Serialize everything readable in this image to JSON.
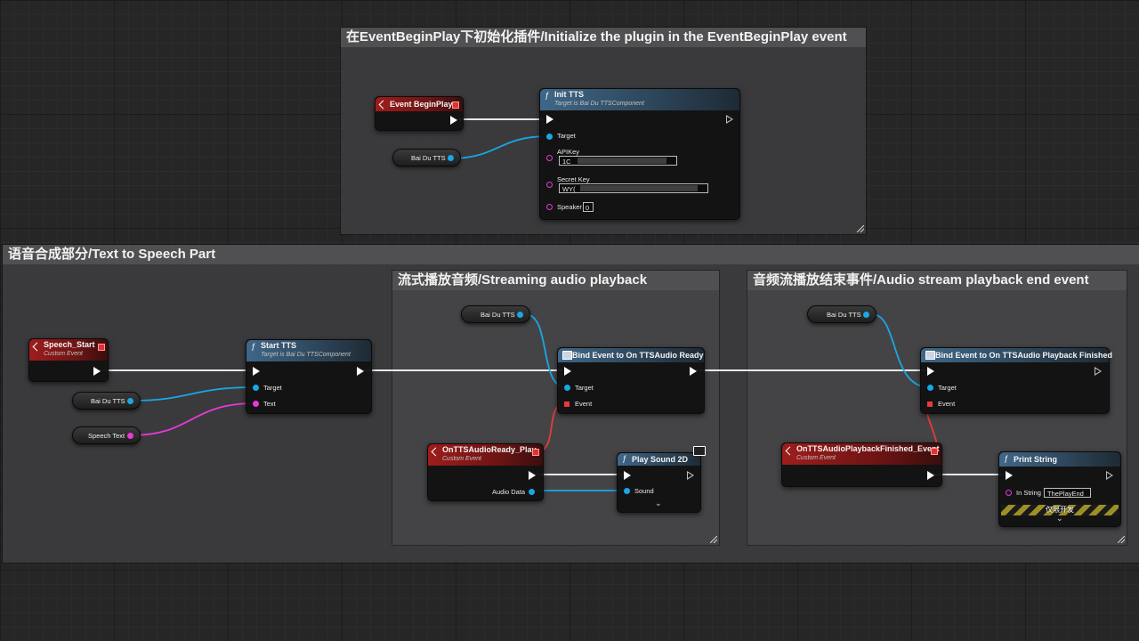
{
  "comments": {
    "init": "在EventBeginPlay下初始化插件/Initialize the plugin in the EventBeginPlay event",
    "tts": "语音合成部分/Text to Speech Part",
    "streaming": "流式播放音频/Streaming audio playback",
    "end_event": "音频流播放结束事件/Audio stream playback end event"
  },
  "nodes": {
    "event_begin_play": {
      "title": "Event BeginPlay"
    },
    "init_tts": {
      "title": "Init TTS",
      "subtitle": "Target is Bai Du TTSComponent",
      "pins": {
        "target": "Target",
        "api_key": "APIKey",
        "secret_key": "Secret Key",
        "speaker": "Speaker"
      },
      "api_key_value": "1C",
      "secret_key_value": "WY(",
      "speaker_value": "0"
    },
    "baidu_tts_var": "Bai Du TTS",
    "speech_start": {
      "title": "Speech_Start",
      "subtitle": "Custom Event"
    },
    "speech_text_var": "Speech Text",
    "start_tts": {
      "title": "Start TTS",
      "subtitle": "Target is Bai Du TTSComponent",
      "pins": {
        "target": "Target",
        "text": "Text"
      }
    },
    "bind_ready": {
      "title": "Bind Event to On TTSAudio Ready",
      "pins": {
        "target": "Target",
        "event": "Event"
      }
    },
    "on_ready_play": {
      "title": "OnTTSAudioReady_Play",
      "subtitle": "Custom Event",
      "pins": {
        "audio_data": "Audio Data"
      }
    },
    "play_sound": {
      "title": "Play Sound 2D",
      "pins": {
        "sound": "Sound"
      }
    },
    "bind_finished": {
      "title": "Bind Event to On TTSAudio Playback Finished",
      "pins": {
        "target": "Target",
        "event": "Event"
      }
    },
    "on_finished": {
      "title": "OnTTSAudioPlaybackFinished_Event",
      "subtitle": "Custom Event"
    },
    "print_string": {
      "title": "Print String",
      "pins": {
        "in_string": "In String"
      },
      "in_string_value": "ThePlayEnd",
      "dev_only": "仅限开发"
    }
  },
  "colors": {
    "exec": "#ffffff",
    "object_pin": "#19a7e6",
    "string_pin": "#e53ad8",
    "delegate_pin": "#e63b3b",
    "function_header": "#3f6788",
    "event_header": "#9e1d1d"
  },
  "icons": {
    "function": "function-icon",
    "event": "event-icon",
    "delegate": "delegate-icon",
    "client_only": "monitor-icon"
  }
}
